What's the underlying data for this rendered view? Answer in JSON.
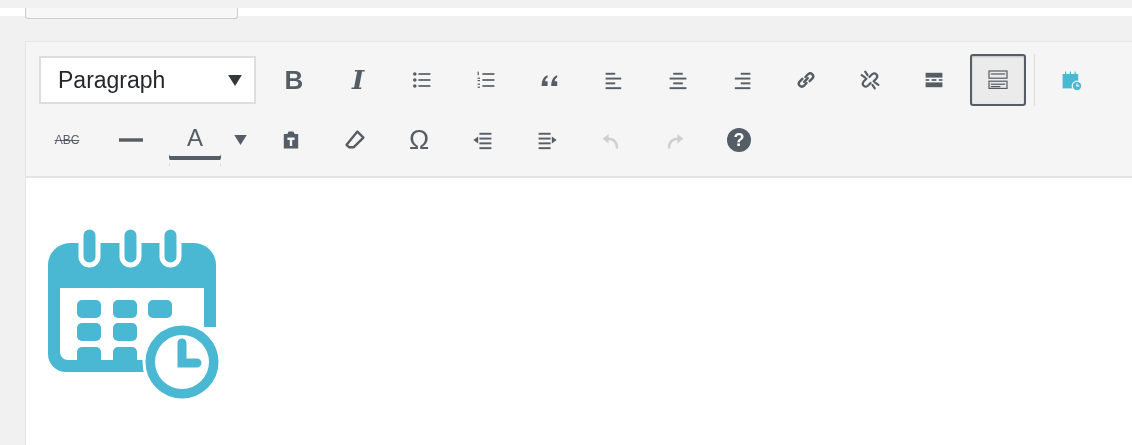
{
  "format_select": {
    "value": "Paragraph"
  },
  "toolbar_rows": [
    [
      {
        "kind": "text",
        "label": "B",
        "pressed": false,
        "disabled": false
      },
      {
        "kind": "text",
        "label": "I",
        "pressed": false,
        "disabled": false
      },
      {
        "kind": "icon",
        "pressed": false,
        "disabled": false
      },
      {
        "kind": "icon",
        "pressed": false,
        "disabled": false
      },
      {
        "kind": "icon",
        "pressed": false,
        "disabled": false
      },
      {
        "kind": "icon",
        "pressed": false,
        "disabled": false
      },
      {
        "kind": "icon",
        "pressed": false,
        "disabled": false
      },
      {
        "kind": "icon",
        "pressed": false,
        "disabled": false
      },
      {
        "kind": "icon",
        "pressed": false,
        "disabled": false
      },
      {
        "kind": "icon",
        "pressed": false,
        "disabled": false
      },
      {
        "kind": "icon",
        "pressed": false,
        "disabled": false
      },
      {
        "kind": "icon",
        "pressed": true,
        "disabled": false
      },
      {
        "kind": "separator"
      },
      {
        "kind": "icon",
        "pressed": false,
        "disabled": false
      }
    ],
    [
      {
        "kind": "text",
        "label": "ABC",
        "pressed": false,
        "disabled": false
      },
      {
        "kind": "icon",
        "pressed": false,
        "disabled": false
      },
      {
        "kind": "color",
        "label": "A",
        "pressed": false,
        "disabled": false
      },
      {
        "kind": "caret",
        "pressed": false,
        "disabled": false
      },
      {
        "kind": "icon",
        "pressed": false,
        "disabled": false
      },
      {
        "kind": "icon",
        "pressed": false,
        "disabled": false
      },
      {
        "kind": "text",
        "label": "Ω",
        "pressed": false,
        "disabled": false
      },
      {
        "kind": "icon",
        "pressed": false,
        "disabled": false
      },
      {
        "kind": "icon",
        "pressed": false,
        "disabled": false
      },
      {
        "kind": "icon",
        "pressed": false,
        "disabled": true
      },
      {
        "kind": "icon",
        "pressed": false,
        "disabled": true
      },
      {
        "kind": "help",
        "label": "?",
        "pressed": false,
        "disabled": false
      }
    ]
  ],
  "content": {
    "kind": "calendar-image"
  }
}
